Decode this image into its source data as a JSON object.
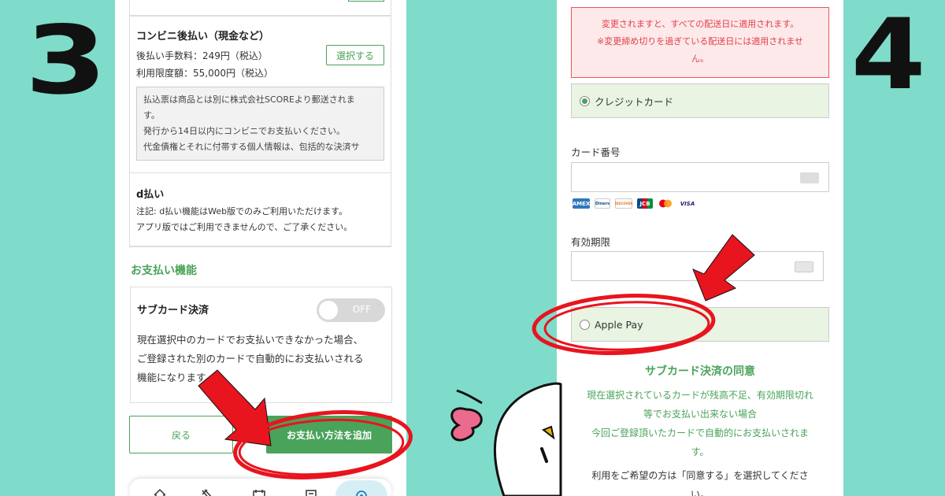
{
  "steps": {
    "left": "3",
    "right": "4"
  },
  "left_phone": {
    "convenience": {
      "title": "コンビニ後払い（現金など）",
      "fee": "後払い手数料：249円（税込）",
      "limit": "利用限度額：55,000円（税込）",
      "select_label": "選択する",
      "note_lines": [
        "払込票は商品とは別に株式会社SCOREより郵送されま",
        "す。",
        "発行から14日以内にコンビニでお支払いください。",
        "代金債権とそれに付帯する個人情報は、包括的な決済サ"
      ]
    },
    "dpay": {
      "title": "d払い",
      "note_lines": [
        "注記: d払い機能はWeb版でのみご利用いただけます。",
        "アプリ版ではご利用できませんので、ご了承ください。"
      ]
    },
    "payment_features_heading": "お支払い機能",
    "sub_card": {
      "title": "サブカード決済",
      "toggle_label": "OFF",
      "toggle_on": false,
      "desc_lines": [
        "現在選択中のカードでお支払いできなかった場合、",
        "ご登録された別のカードで自動的にお支払いされる",
        "機能になります。"
      ]
    },
    "back_label": "戻る",
    "add_label": "お支払い方法を追加"
  },
  "right_phone": {
    "warning_lines": [
      "変更されますと、すべての配送日に適用されます。",
      "※変更締め切りを過ぎている配送日には適用されませ",
      "ん。"
    ],
    "credit_label": "クレジットカード",
    "card_number_label": "カード番号",
    "expiry_label": "有効期限",
    "apple_pay_label": "Apple Pay",
    "brands": [
      "AMEX",
      "Diners",
      "DISCOVER",
      "JCB",
      "MC",
      "VISA"
    ],
    "consent_title": "サブカード決済の同意",
    "consent_lines": [
      "現在選択されているカードが残高不足、有効期限切れ",
      "等でお支払い出来ない場合",
      "今回ご登録頂いたカードで自動的にお支払いされま",
      "す。"
    ],
    "consent_lines2": [
      "利用をご希望の方は「同意する」を選択してくださ",
      "い。"
    ]
  },
  "colors": {
    "background": "#7fdcca",
    "accent_green": "#4aa35a",
    "annotation_red": "#e8141e",
    "warning_red": "#e0404a"
  },
  "icons": [
    "home-icon",
    "food-icon",
    "calendar-icon",
    "history-icon",
    "settings-icon",
    "card-icon",
    "arrow-annotation",
    "circle-annotation"
  ]
}
